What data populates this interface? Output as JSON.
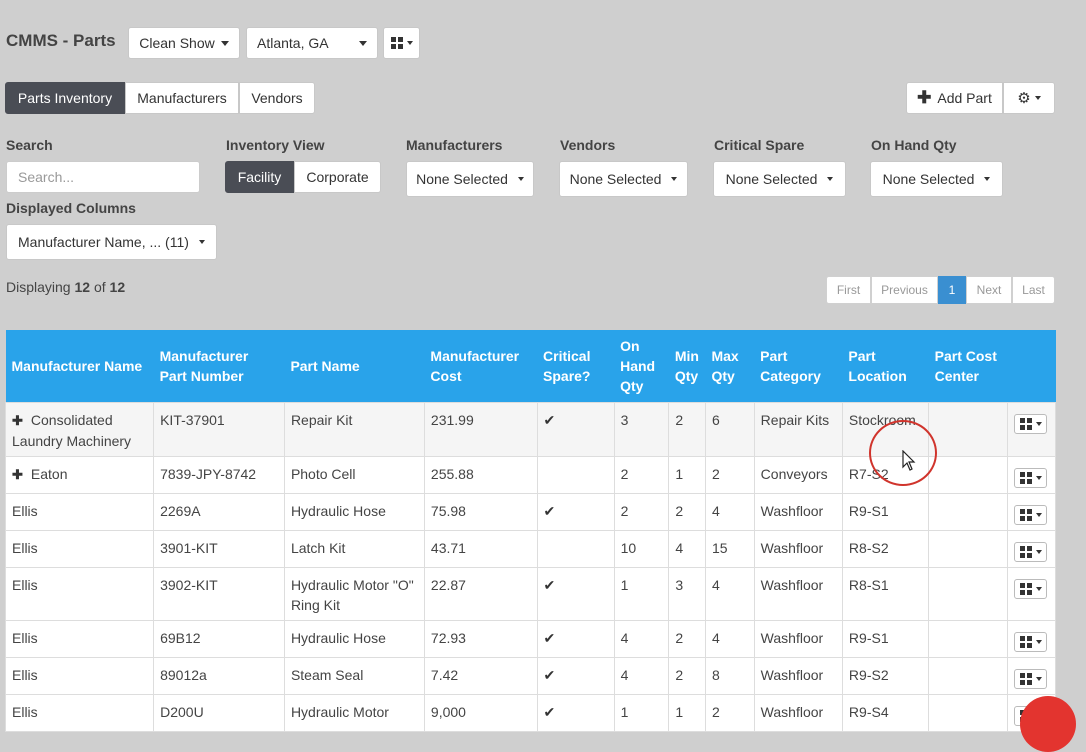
{
  "header": {
    "title": "CMMS - Parts",
    "show_dropdown": "Clean Show",
    "location_dropdown": "Atlanta, GA"
  },
  "tabs": [
    {
      "label": "Parts Inventory",
      "active": true
    },
    {
      "label": "Manufacturers",
      "active": false
    },
    {
      "label": "Vendors",
      "active": false
    }
  ],
  "toolbar": {
    "add_part": "Add Part"
  },
  "filters": {
    "search_label": "Search",
    "search_placeholder": "Search...",
    "inventory_view_label": "Inventory View",
    "inventory_view_options": [
      "Facility",
      "Corporate"
    ],
    "manufacturers_label": "Manufacturers",
    "manufacturers_value": "None Selected",
    "vendors_label": "Vendors",
    "vendors_value": "None Selected",
    "critical_label": "Critical Spare",
    "critical_value": "None Selected",
    "onhand_label": "On Hand Qty",
    "onhand_value": "None Selected",
    "columns_label": "Displayed Columns",
    "columns_value": "Manufacturer Name, ... (11)"
  },
  "display": {
    "prefix": "Displaying",
    "shown": "12",
    "of": "of",
    "total": "12"
  },
  "pagination": [
    "First",
    "Previous",
    "1",
    "Next",
    "Last"
  ],
  "table": {
    "headers": [
      "Manufacturer Name",
      "Manufacturer Part Number",
      "Part Name",
      "Manufacturer Cost",
      "Critical Spare?",
      "On Hand Qty",
      "Min Qty",
      "Max Qty",
      "Part Category",
      "Part Location",
      "Part Cost Center"
    ],
    "rows": [
      {
        "expand": true,
        "mfr": "Consolidated Laundry Machinery",
        "pn": "KIT-37901",
        "name": "Repair Kit",
        "cost": "231.99",
        "critical": true,
        "onhand": "3",
        "min": "2",
        "max": "6",
        "cat": "Repair Kits",
        "loc": "Stockroom",
        "cc": ""
      },
      {
        "expand": true,
        "mfr": "Eaton",
        "pn": "7839-JPY-8742",
        "name": "Photo Cell",
        "cost": "255.88",
        "critical": false,
        "onhand": "2",
        "min": "1",
        "max": "2",
        "cat": "Conveyors",
        "loc": "R7-S2",
        "cc": ""
      },
      {
        "expand": false,
        "mfr": "Ellis",
        "pn": "2269A",
        "name": "Hydraulic Hose",
        "cost": "75.98",
        "critical": true,
        "onhand": "2",
        "min": "2",
        "max": "4",
        "cat": "Washfloor",
        "loc": "R9-S1",
        "cc": ""
      },
      {
        "expand": false,
        "mfr": "Ellis",
        "pn": "3901-KIT",
        "name": "Latch Kit",
        "cost": "43.71",
        "critical": false,
        "onhand": "10",
        "min": "4",
        "max": "15",
        "cat": "Washfloor",
        "loc": "R8-S2",
        "cc": ""
      },
      {
        "expand": false,
        "mfr": "Ellis",
        "pn": "3902-KIT",
        "name": "Hydraulic Motor \"O\" Ring Kit",
        "cost": "22.87",
        "critical": true,
        "onhand": "1",
        "min": "3",
        "max": "4",
        "cat": "Washfloor",
        "loc": "R8-S1",
        "cc": ""
      },
      {
        "expand": false,
        "mfr": "Ellis",
        "pn": "69B12",
        "name": "Hydraulic Hose",
        "cost": "72.93",
        "critical": true,
        "onhand": "4",
        "min": "2",
        "max": "4",
        "cat": "Washfloor",
        "loc": "R9-S1",
        "cc": ""
      },
      {
        "expand": false,
        "mfr": "Ellis",
        "pn": "89012a",
        "name": "Steam Seal",
        "cost": "7.42",
        "critical": true,
        "onhand": "4",
        "min": "2",
        "max": "8",
        "cat": "Washfloor",
        "loc": "R9-S2",
        "cc": ""
      },
      {
        "expand": false,
        "mfr": "Ellis",
        "pn": "D200U",
        "name": "Hydraulic Motor",
        "cost": "9,000",
        "critical": true,
        "onhand": "1",
        "min": "1",
        "max": "2",
        "cat": "Washfloor",
        "loc": "R9-S4",
        "cc": ""
      }
    ]
  },
  "colors": {
    "header_blue": "#29a3ea",
    "active_tab": "#4a4d55",
    "pager_active": "#3a8fd1",
    "cursor_ring": "#d0342c"
  }
}
